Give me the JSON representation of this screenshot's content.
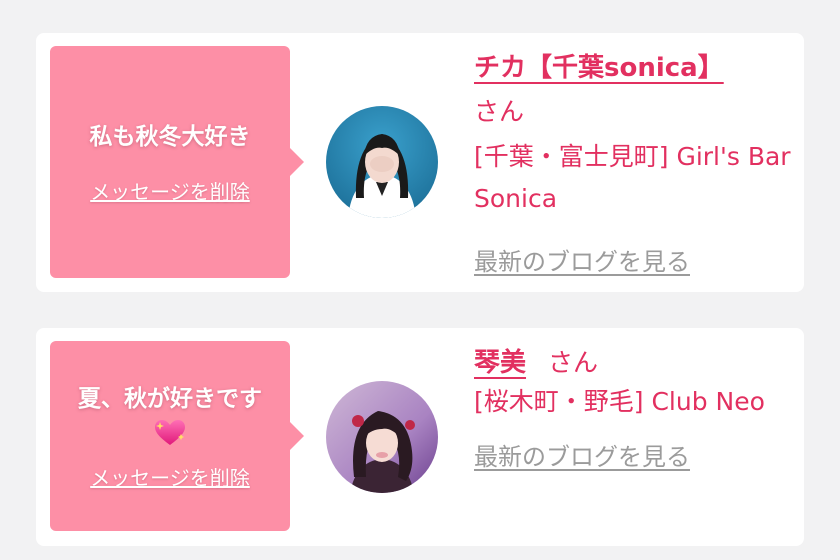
{
  "messages": [
    {
      "bubble_text": "私も秋冬大好き",
      "delete_label": "メッセージを削除",
      "name": "チカ【千葉sonica】",
      "honorific": "さん",
      "location": "[千葉・富士見町] Girl's Bar Sonica",
      "blog_label": "最新のブログを見る"
    },
    {
      "bubble_text": "夏、秋が好きです",
      "bubble_emoji": "sparkling-heart-icon",
      "delete_label": "メッセージを削除",
      "name": "琴美",
      "honorific": "さん",
      "location": "[桜木町・野毛] Club Neo",
      "blog_label": "最新のブログを見る"
    }
  ],
  "colors": {
    "background": "#f2f2f3",
    "card": "#ffffff",
    "bubble": "#fd8fa6",
    "accent": "#e23060",
    "muted_link": "#9b9b9b"
  }
}
